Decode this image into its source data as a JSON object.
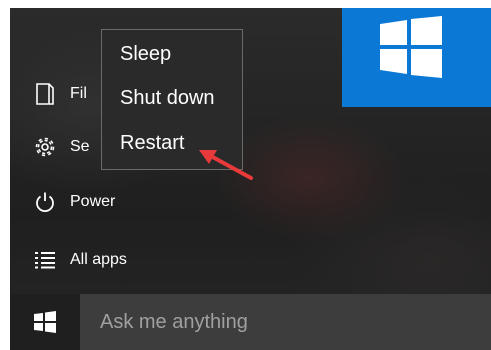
{
  "start_menu": {
    "items": [
      {
        "label": "File Explorer",
        "visible_label": "Fil",
        "icon": "file-icon"
      },
      {
        "label": "Settings",
        "visible_label": "Se",
        "icon": "gear-icon"
      },
      {
        "label": "Power",
        "visible_label": "Power",
        "icon": "power-icon"
      },
      {
        "label": "All apps",
        "visible_label": "All apps",
        "icon": "list-icon"
      }
    ]
  },
  "power_flyout": {
    "options": [
      "Sleep",
      "Shut down",
      "Restart"
    ]
  },
  "taskbar": {
    "search_placeholder": "Ask me anything",
    "start_icon": "windows-logo-icon"
  },
  "colors": {
    "accent": "#0a78d4",
    "annotation_arrow": "#e83a3a"
  }
}
